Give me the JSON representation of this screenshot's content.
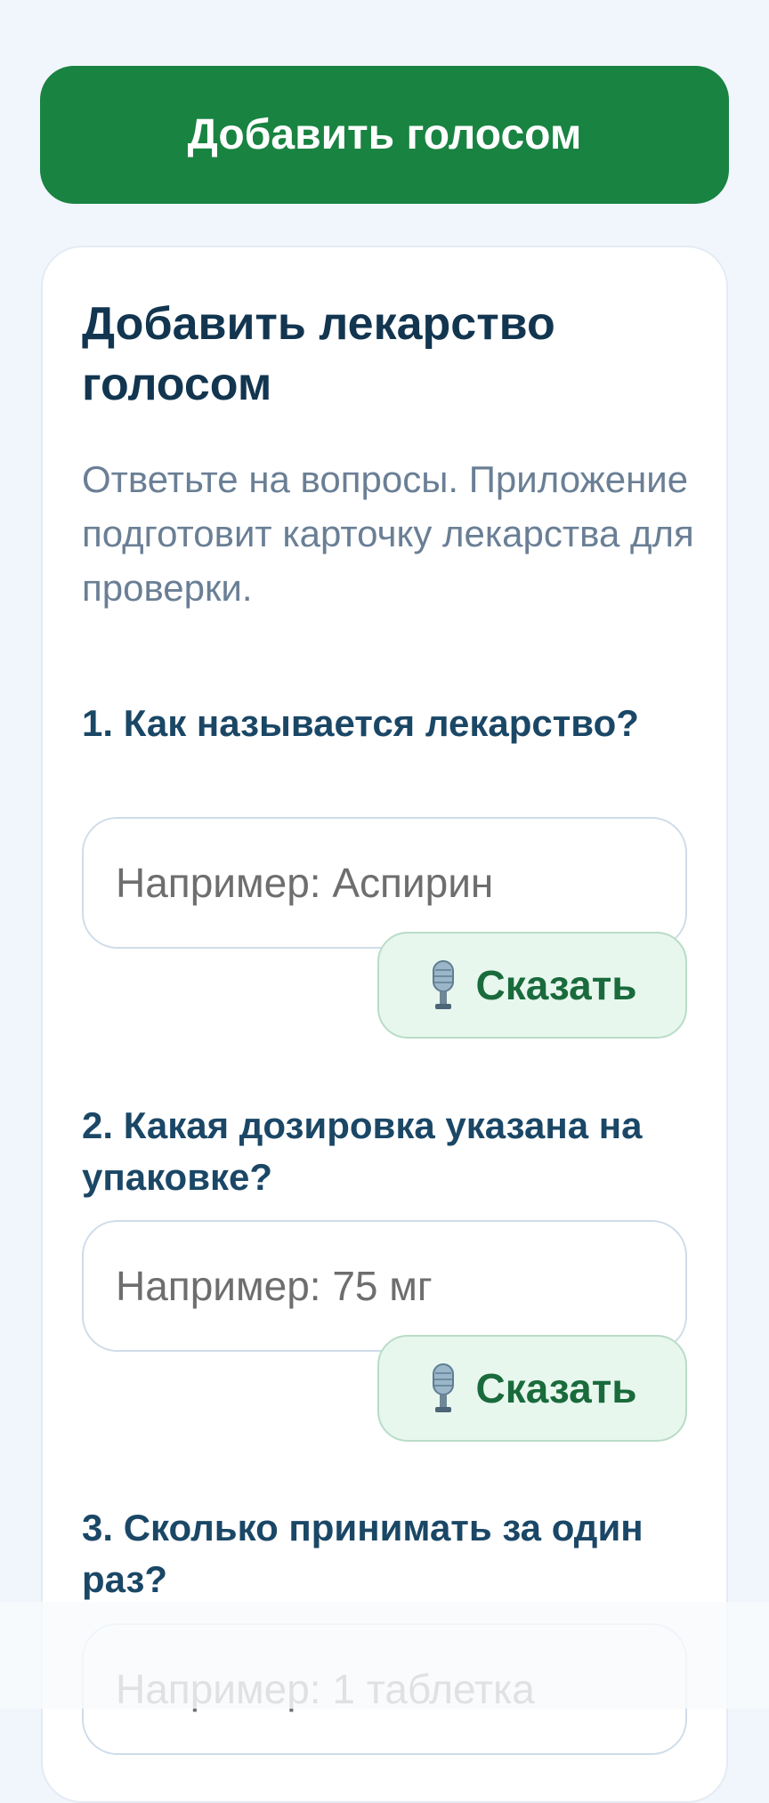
{
  "top_button": {
    "label": "Добавить голосом"
  },
  "card": {
    "title": "Добавить лекарство голосом",
    "subtitle": "Ответьте на вопросы. Приложение подготовит карточку лекарства для проверки."
  },
  "questions": [
    {
      "label": "1. Как называется лекарство?",
      "placeholder": "Например: Аспирин",
      "speak_label": "Сказать"
    },
    {
      "label": "2. Какая дозировка указана на упаковке?",
      "placeholder": "Например: 75 мг",
      "speak_label": "Сказать"
    },
    {
      "label": "3. Сколько принимать за один раз?",
      "placeholder": "Например: 1 таблетка"
    }
  ],
  "icons": {
    "speak": "microphone-icon"
  },
  "colors": {
    "primary_green": "#198341",
    "speak_bg": "#e8f7ee",
    "speak_text": "#1a6b3c",
    "title": "#123550",
    "question": "#1b4766",
    "subtitle": "#6a7f95",
    "page_bg": "#f1f6fc"
  }
}
